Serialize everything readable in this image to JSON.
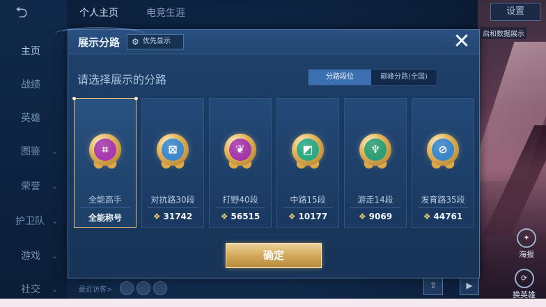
{
  "background": {
    "sidebar": [
      {
        "label": "主页",
        "chevron": false,
        "active": true
      },
      {
        "label": "战绩",
        "chevron": false
      },
      {
        "label": "英雄",
        "chevron": false
      },
      {
        "label": "图鉴",
        "chevron": true
      },
      {
        "label": "荣誉",
        "chevron": true
      },
      {
        "label": "护卫队",
        "chevron": true
      },
      {
        "label": "游戏",
        "chevron": true
      },
      {
        "label": "社交",
        "chevron": true
      }
    ],
    "top_tabs": [
      "个人主页",
      "电竞生涯"
    ],
    "settings_label": "设置",
    "right_link": "启和数据展示",
    "right_buttons": [
      "海报",
      "换英雄"
    ],
    "bottom_text": "最近访客>"
  },
  "modal": {
    "title": "展示分路",
    "priority_button": "优先显示",
    "subtitle": "请选择展示的分路",
    "segment": {
      "active": "分路段位",
      "inactive": "巅峰分路(全国)"
    },
    "confirm": "确定",
    "cards": [
      {
        "label": "全能高手",
        "value": "全能称号",
        "has_points_icon": false,
        "icon": "all-round-icon",
        "color": "#a330b8",
        "selected": true
      },
      {
        "label": "对抗路30段",
        "value": "31742",
        "has_points_icon": true,
        "icon": "clash-lane-icon",
        "color": "#2f86d9"
      },
      {
        "label": "打野40段",
        "value": "56515",
        "has_points_icon": true,
        "icon": "jungle-dragon-icon",
        "color": "#a02fb3"
      },
      {
        "label": "中路15段",
        "value": "10177",
        "has_points_icon": true,
        "icon": "mid-lane-icon",
        "color": "#1fa889"
      },
      {
        "label": "游走14段",
        "value": "9069",
        "has_points_icon": true,
        "icon": "roam-icon",
        "color": "#1f9d7a"
      },
      {
        "label": "发育路35段",
        "value": "44761",
        "has_points_icon": true,
        "icon": "farm-lane-icon",
        "color": "#2d84d6"
      }
    ]
  }
}
